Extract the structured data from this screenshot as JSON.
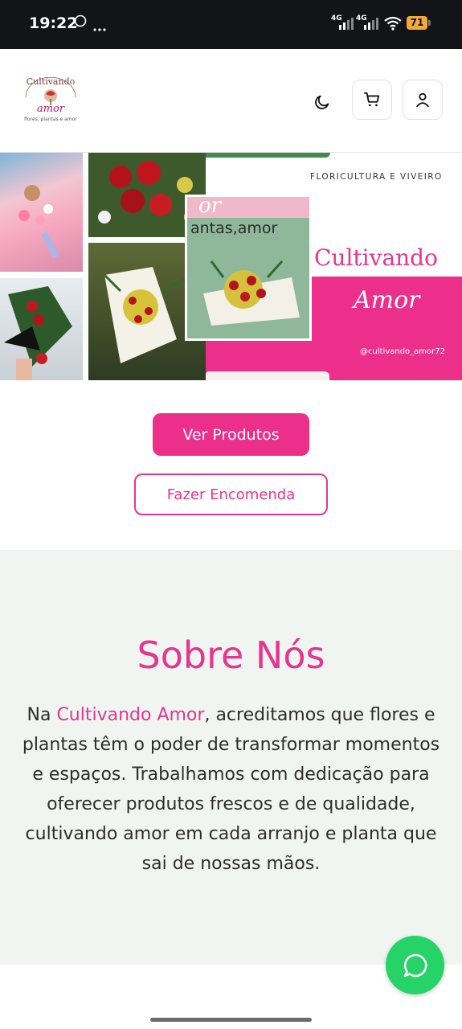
{
  "status_bar": {
    "time": "19:22",
    "battery": "71",
    "network_1": "4G",
    "network_2": "4G"
  },
  "header": {
    "logo": {
      "text_top": "Cultivando",
      "text_main": "amor",
      "tagline": "flores, plantas e amor"
    },
    "theme_icon": "moon-icon",
    "cart_icon": "cart-icon",
    "user_icon": "user-icon"
  },
  "hero": {
    "subtitle": "FLORICULTURA E VIVEIRO",
    "brand_title": "Cultivando",
    "brand_script": "Amor",
    "handle": "@cultivando_amor72",
    "sign_text": "antas,amor",
    "sign_text_top": "or"
  },
  "actions": {
    "primary_label": "Ver Produtos",
    "secondary_label": "Fazer Encomenda"
  },
  "about": {
    "title": "Sobre Nós",
    "text_before": "Na ",
    "brand": "Cultivando Amor",
    "text_after": ", acreditamos que flores e plantas têm o poder de transformar momentos e espaços. Trabalhamos com dedicação para oferecer produtos frescos e de qualidade, cultivando amor em cada arranjo e planta que sai de nossas mãos."
  },
  "colors": {
    "accent": "#e6358e",
    "whatsapp": "#25d366",
    "about_bg": "#f0f5f2"
  }
}
